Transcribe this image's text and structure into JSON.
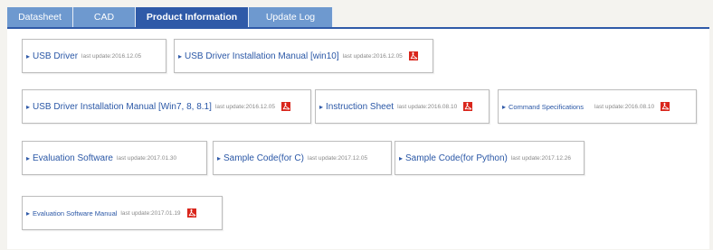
{
  "tabs": [
    {
      "label": "Datasheet"
    },
    {
      "label": "CAD"
    },
    {
      "label": "Product Information"
    },
    {
      "label": "Update Log"
    }
  ],
  "active_tab": "Product Information",
  "accent_color": "#2f5aa8",
  "tab_color": "#6e99cf",
  "items": [
    {
      "title": "USB Driver",
      "update": "last update:2016.12.05",
      "pdf": false
    },
    {
      "title": "USB Driver Installation Manual [win10]",
      "update": "last update:2016.12.05",
      "pdf": true,
      "icon": "pdf-icon"
    },
    {
      "title": "USB Driver Installation Manual [Win7, 8, 8.1]",
      "update": "last update:2016.12.05",
      "pdf": true,
      "icon": "pdf-icon"
    },
    {
      "title": "Instruction Sheet",
      "update": "last update:2016.08.10",
      "pdf": true,
      "icon": "pdf-icon"
    },
    {
      "title": "Command Specifications",
      "update": "last update:2016.08.10",
      "pdf": true,
      "icon": "pdf-icon"
    },
    {
      "title": "Evaluation Software",
      "update": "last update:2017.01.30",
      "pdf": false
    },
    {
      "title": "Sample Code(for C)",
      "update": "last update:2017.12.05",
      "pdf": false
    },
    {
      "title": "Sample Code(for Python)",
      "update": "last update:2017.12.26",
      "pdf": false
    },
    {
      "title": "Evaluation Software Manual",
      "update": "last update:2017.01.19",
      "pdf": true,
      "icon": "pdf-icon"
    }
  ]
}
